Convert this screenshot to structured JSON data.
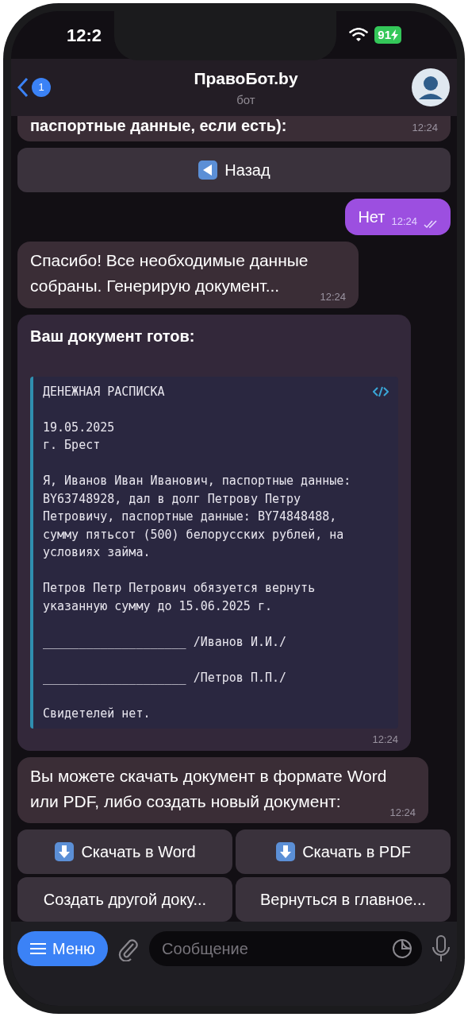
{
  "status_bar": {
    "time": "12:2",
    "battery": "91"
  },
  "header": {
    "back_count": "1",
    "title": "ПравоБот.by",
    "subtitle": "бот"
  },
  "messages": [
    {
      "kind": "partial",
      "text": "паспортные данные, если есть):",
      "time": "12:24"
    },
    {
      "kind": "buttons",
      "rows": [
        [
          {
            "label": "Назад",
            "kind": "back"
          }
        ]
      ]
    },
    {
      "kind": "outgoing",
      "text": "Нет",
      "time": "12:24",
      "read": true
    },
    {
      "kind": "incoming",
      "text": "Спасибо! Все необходимые данные собраны. Генерирую документ...",
      "time": "12:24"
    },
    {
      "kind": "code",
      "title": "Ваш документ готов:",
      "time": "12:24",
      "paragraphs": [
        [
          "ДЕНЕЖНАЯ РАСПИСКА"
        ],
        [
          "19.05.2025",
          "г. Брест"
        ],
        [
          "Я, Иванов Иван Иванович, паспортные данные:",
          "BY63748928, дал в долг Петрову Петру",
          "Петровичу, паспортные данные: BY74848488,",
          "сумму пятьсот (500) белорусских рублей, на",
          "условиях займа."
        ],
        [
          "Петров Петр Петрович обязуется вернуть",
          "указанную сумму до 15.06.2025 г."
        ],
        [
          "____________________ /Иванов И.И./"
        ],
        [
          "____________________ /Петров П.П./"
        ],
        [
          "Свидетелей нет."
        ]
      ]
    },
    {
      "kind": "incoming",
      "text": "Вы можете скачать документ в формате Word или PDF, либо создать новый документ:",
      "time": "12:24"
    },
    {
      "kind": "buttons",
      "rows": [
        [
          {
            "label": "Скачать в Word",
            "kind": "download"
          },
          {
            "label": "Скачать в PDF",
            "kind": "download"
          }
        ],
        [
          {
            "label": "Создать другой доку...",
            "kind": "text"
          },
          {
            "label": "Вернуться в главное...",
            "kind": "text"
          }
        ]
      ]
    }
  ],
  "composer": {
    "menu": "Меню",
    "placeholder": "Сообщение"
  }
}
